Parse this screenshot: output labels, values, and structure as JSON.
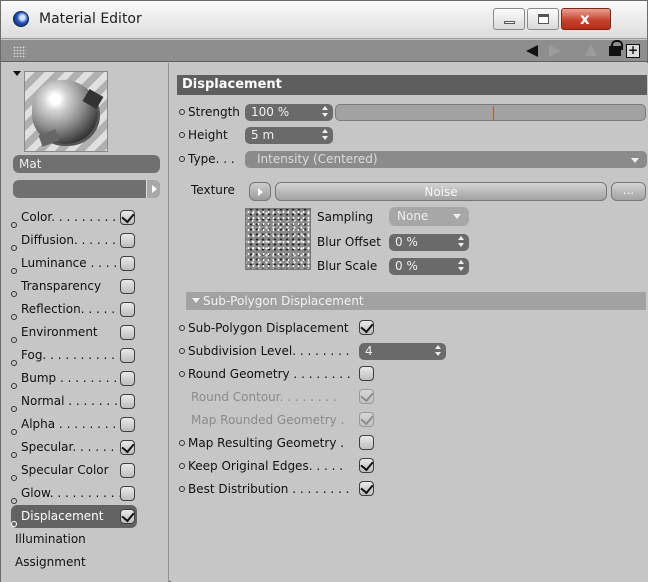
{
  "window": {
    "title": "Material Editor",
    "close_glyph": "x"
  },
  "toolbar": {
    "icons": [
      "grip-icon",
      "back-arrow-icon",
      "forward-arrow-icon",
      "up-arrow-icon",
      "lock-icon",
      "new-window-icon"
    ]
  },
  "material": {
    "name": "Mat"
  },
  "channels": [
    {
      "label": "Color. . . . . . . . . .",
      "checked": true
    },
    {
      "label": "Diffusion. . . . . . .",
      "checked": false
    },
    {
      "label": "Luminance . . . . .",
      "checked": false
    },
    {
      "label": "Transparency",
      "checked": false
    },
    {
      "label": "Reflection. . . . . .",
      "checked": false
    },
    {
      "label": "Environment",
      "checked": false
    },
    {
      "label": "Fog. . . . . . . . . . .",
      "checked": false
    },
    {
      "label": "Bump . . . . . . . . .",
      "checked": false
    },
    {
      "label": "Normal . . . . . . . .",
      "checked": false
    },
    {
      "label": "Alpha . . . . . . . . .",
      "checked": false
    },
    {
      "label": "Specular. . . . . .",
      "checked": true
    },
    {
      "label": "Specular Color",
      "checked": false
    },
    {
      "label": "Glow. . . . . . . . . .",
      "checked": false
    },
    {
      "label": "Displacement",
      "checked": true,
      "selected": true
    }
  ],
  "extra_channels": [
    "Illumination",
    "Assignment"
  ],
  "displacement": {
    "section_title": "Displacement",
    "strength_label": "Strength",
    "strength_value": "100 %",
    "strength_fraction": 0.0,
    "height_label": "Height",
    "height_value": "5 m",
    "type_label": "Type. . .",
    "type_value": "Intensity (Centered)",
    "texture_label": "Texture",
    "texture_name": "Noise",
    "texture_more": "...",
    "sampling_label": "Sampling",
    "sampling_value": "None",
    "blur_offset_label": "Blur Offset",
    "blur_offset_value": "0 %",
    "blur_scale_label": "Blur Scale",
    "blur_scale_value": "0 %"
  },
  "subpoly": {
    "section_title": "Sub-Polygon Displacement",
    "items": [
      {
        "label": "Sub-Polygon Displacement",
        "checked": true,
        "enabled": true,
        "dot": true
      },
      {
        "label": "Subdivision Level. . . . . . . .",
        "value": "4",
        "enabled": true,
        "dot": true
      },
      {
        "label": "Round Geometry . . . . . . . .",
        "checked": false,
        "enabled": true,
        "dot": true
      },
      {
        "label": "Round Contour. . . . . . . .",
        "checked": true,
        "enabled": false,
        "dot": false
      },
      {
        "label": "Map Rounded Geometry .",
        "checked": true,
        "enabled": false,
        "dot": false
      },
      {
        "label": "Map Resulting Geometry .",
        "checked": false,
        "enabled": true,
        "dot": true
      },
      {
        "label": "Keep Original Edges. . . . .",
        "checked": true,
        "enabled": true,
        "dot": true
      },
      {
        "label": "Best Distribution . . . . . . . .",
        "checked": true,
        "enabled": true,
        "dot": true
      }
    ]
  }
}
